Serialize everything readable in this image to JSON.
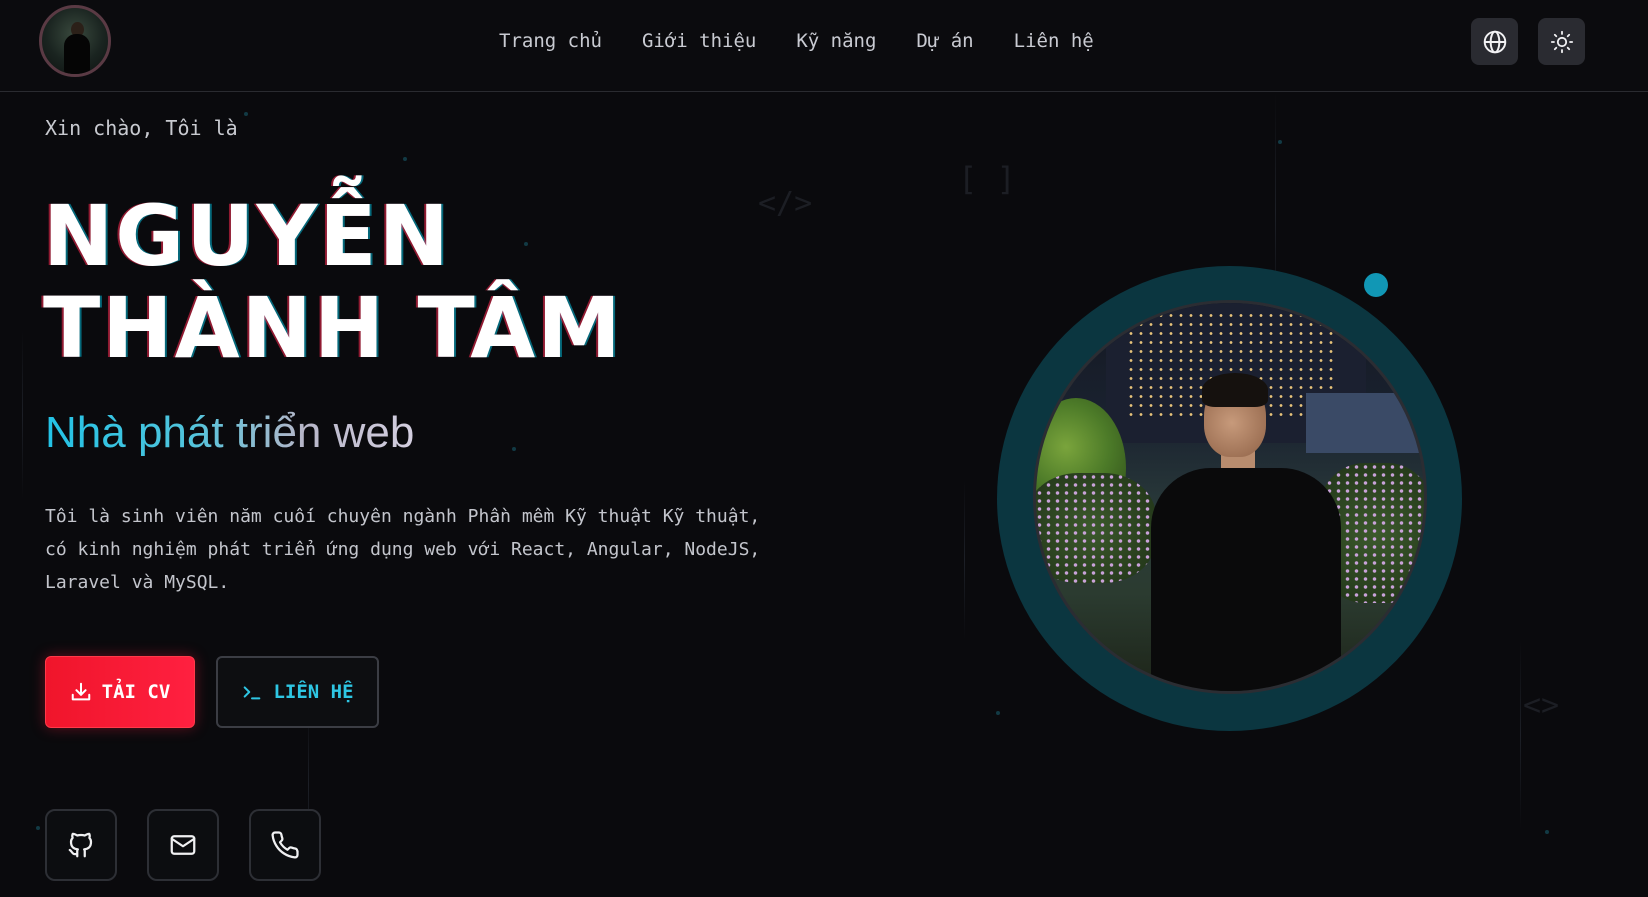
{
  "header": {
    "logo_alt": "avatar",
    "nav": [
      {
        "label": "Trang chủ"
      },
      {
        "label": "Giới thiệu"
      },
      {
        "label": "Kỹ năng"
      },
      {
        "label": "Dự án"
      },
      {
        "label": "Liên hệ"
      }
    ],
    "language_icon": "globe-icon",
    "theme_icon": "sun-icon"
  },
  "hero": {
    "greeting": "Xin chào, Tôi là",
    "name_line1": "NGUYỄN",
    "name_line2": "THÀNH TÂM",
    "role": "Nhà phát triển web",
    "description": "Tôi là sinh viên năm cuối chuyên ngành Phần mềm Kỹ thuật Kỹ thuật, có kinh nghiệm phát triển ứng dụng web với React, Angular, NodeJS, Laravel và MySQL.",
    "download_cv_label": "TẢI CV",
    "contact_label": "LIÊN HỆ"
  },
  "socials": [
    {
      "icon": "github-icon"
    },
    {
      "icon": "mail-icon"
    },
    {
      "icon": "phone-icon"
    }
  ],
  "colors": {
    "background": "#0a0a0d",
    "accent_cyan": "#22c3e6",
    "accent_red": "#f0152b",
    "ring": "#0b3640"
  }
}
